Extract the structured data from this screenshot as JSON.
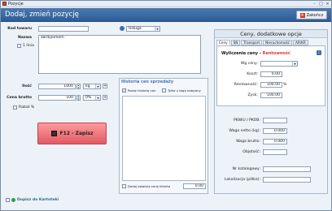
{
  "window": {
    "title": "Pozycje"
  },
  "header": {
    "title": "Dodaj, zmień pozycję",
    "close_label": "Zakończ"
  },
  "form": {
    "kod_label": "Kod towaru",
    "kod_value": "",
    "type_value": "Usługa",
    "nazwa_label": "Nazwa",
    "nazwa_value": "sbrd/joimem",
    "jedna_linia_label": "1 linia",
    "ilosc_label": "Ilość",
    "ilosc_value": "1000",
    "unit_value": "kg",
    "cena_label": "Cena brutto",
    "cena_value": "100",
    "vat_value": "0%",
    "rabat_label": "Rabat %"
  },
  "save_button": {
    "label": "F12 - Zapisz"
  },
  "history": {
    "title": "Historia cen sprzedaży",
    "show_history_label": "Pokaż historię cen",
    "only_buyer_label": "Tylko u tego nabywcy",
    "add_last_price_label": "Dodaj ostatnią cenę klienta",
    "last_price_value": "0.00"
  },
  "right_panel": {
    "title": "Ceny, dodatkowe opcje",
    "tabs": [
      "Ceny",
      "SN",
      "Transport",
      "Nieruchomość",
      "AR/KR"
    ],
    "calc_prefix": "Wyliczenie ceny - ",
    "calc_highlight": "Rentowność",
    "info_label": "i",
    "wg_ceny_label": "Wg ceny:",
    "wg_ceny_value": "",
    "koszt_label": "Koszt:",
    "koszt_value": "0.00",
    "rentownosc_label": "Rentowność:",
    "rentownosc_value": "100.00",
    "rentownosc_unit": "%",
    "zysk_label": "Zysk:",
    "zysk_value": "100.00",
    "pkwiu_label": "PKWiU / PKOB:",
    "pkwiu_value": "",
    "waga_netto_label": "Waga netto (kg):",
    "waga_netto_value": "0.000",
    "waga_brutto_label": "Waga brutto:",
    "waga_brutto_value": "0.000",
    "objetosc_label": "Objętość:",
    "objetosc_value": "",
    "nr_katalogowy_label": "Nr katalogowy:",
    "nr_katalogowy_value": "",
    "lokalizacja_label": "Lokalizacja (półka):",
    "lokalizacja_value": ""
  },
  "footer": {
    "dopisz_label": "Dopisz do Kartoteki"
  }
}
